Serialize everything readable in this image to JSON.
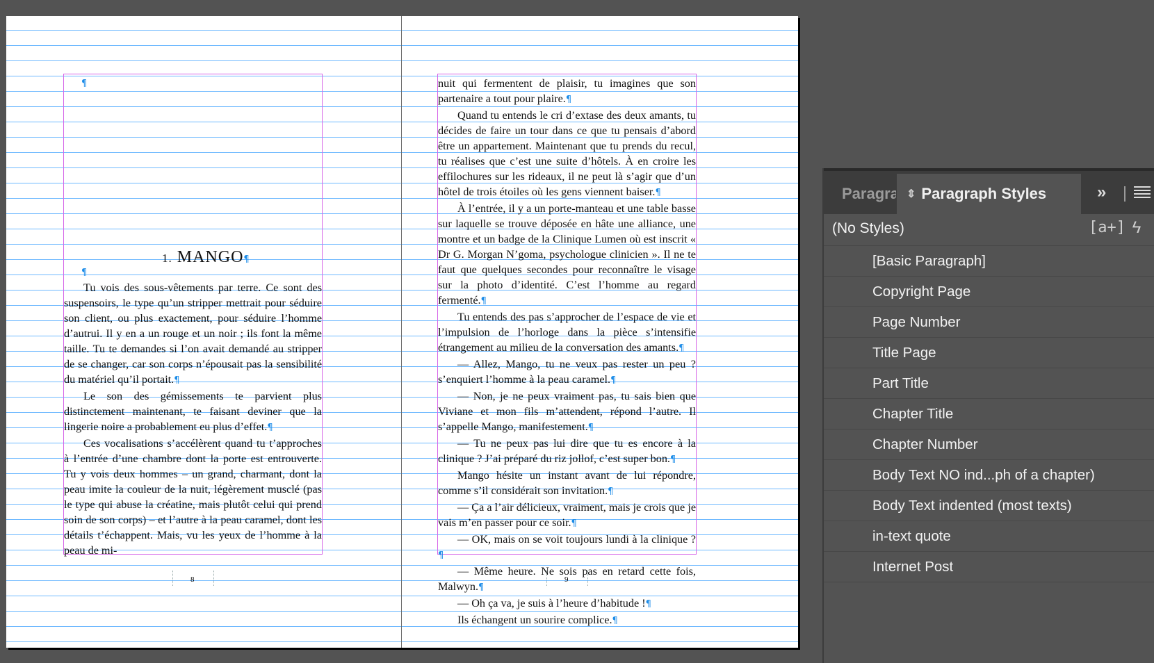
{
  "document": {
    "left_page": {
      "empty_para_mark": "¶",
      "chapter_number": "1.",
      "chapter_title": "MANGO",
      "paragraphs": [
        "Tu vois des sous-vêtements par terre. Ce sont des suspensoirs, le type qu’un stripper mettrait pour séduire son client, ou plus exactement, pour séduire l’homme d’autrui. Il y en a un rouge et un noir ; ils font la même taille. Tu te demandes si l’on avait demandé au stripper de se changer, car son corps n’épousait pas la sensibilité du matériel qu’il portait.",
        "Le son des gémissements te parvient plus distinctement maintenant, te faisant deviner que la lingerie noire a probablement eu plus d’effet.",
        "Ces vocalisations s’accélèrent quand tu t’approches à l’entrée d’une chambre dont la porte est entrouverte. Tu y vois deux hommes – un grand, charmant, dont la peau imite la couleur de la nuit, légèrement musclé (pas le type qui abuse la créatine, mais plutôt celui qui prend soin de son corps) – et l’autre à la peau caramel, dont les détails t’échappent. Mais, vu les yeux de l’homme à la peau de mi-"
      ],
      "folio": "8"
    },
    "right_page": {
      "paragraphs": [
        {
          "text": "nuit qui fermentent de plaisir, tu imagines que son partenaire a tout pour plaire.",
          "indent": false
        },
        {
          "text": "Quand tu entends le cri d’extase des deux amants, tu décides de faire un tour dans ce que tu pensais d’abord être un appartement. Maintenant que tu prends du recul, tu réalises que c’est une suite d’hôtels. À en croire les effilochures sur les rideaux, il ne peut là s’agir que d’un hôtel de trois étoiles où les gens viennent baiser.",
          "indent": true
        },
        {
          "text": "À l’entrée, il y a un porte-manteau et une table basse sur laquelle se trouve déposée en hâte une alliance, une montre et un badge de la Clinique Lumen où est inscrit « Dr G. Morgan N’goma, psychologue clinicien ». Il ne te faut que quelques secondes pour reconnaître le visage sur la photo d’identité. C’est l’homme au regard fermenté.",
          "indent": true
        },
        {
          "text": "Tu entends des pas s’approcher de l’espace de vie et l’impulsion de l’horloge dans la pièce s’intensifie étrangement au milieu de la conversation des amants.",
          "indent": true
        },
        {
          "text": "— Allez, Mango, tu ne veux pas rester un peu ? s’enquiert l’homme à la peau caramel.",
          "indent": true
        },
        {
          "text": "— Non, je ne peux vraiment pas, tu sais bien que Viviane et mon fils m’attendent, répond l’autre. Il s’appelle Mango, manifestement.",
          "indent": true
        },
        {
          "text": "— Tu ne peux pas lui dire que tu es encore à la clinique ? J’ai préparé du riz jollof, c’est super bon.",
          "indent": true
        },
        {
          "text": "Mango hésite un instant avant de lui répondre, comme s’il considérait son invitation.",
          "indent": true
        },
        {
          "text": "— Ça a l’air délicieux, vraiment, mais je crois que je vais m’en passer pour ce soir.",
          "indent": true
        },
        {
          "text": "— OK, mais on se voit toujours lundi à la clinique ?",
          "indent": true
        },
        {
          "text": "— Même heure. Ne sois pas en retard cette fois, Malwyn.",
          "indent": true
        },
        {
          "text": "— Oh ça va, je suis à l’heure d’habitude !",
          "indent": true
        },
        {
          "text": "Ils échangent un sourire complice.",
          "indent": true
        }
      ],
      "folio": "9"
    },
    "pilcrow": "¶"
  },
  "panel": {
    "inactive_tab": "Paragraph",
    "active_tab": "Paragraph Styles",
    "current_style": "(No Styles)",
    "new_style_icon_text": "[a+]",
    "styles": [
      "[Basic Paragraph]",
      "Copyright Page",
      "Page Number",
      "Title Page",
      "Part Title",
      "Chapter Title",
      "Chapter Number",
      "Body Text NO ind...ph of a chapter)",
      "Body Text indented (most texts)",
      "in-text quote",
      "Internet Post"
    ]
  },
  "colors": {
    "baseline_grid": "#3ea2ff",
    "margin_guide": "#d667e8",
    "pasteboard": "#535353",
    "panel_header": "#3c3c3c"
  }
}
